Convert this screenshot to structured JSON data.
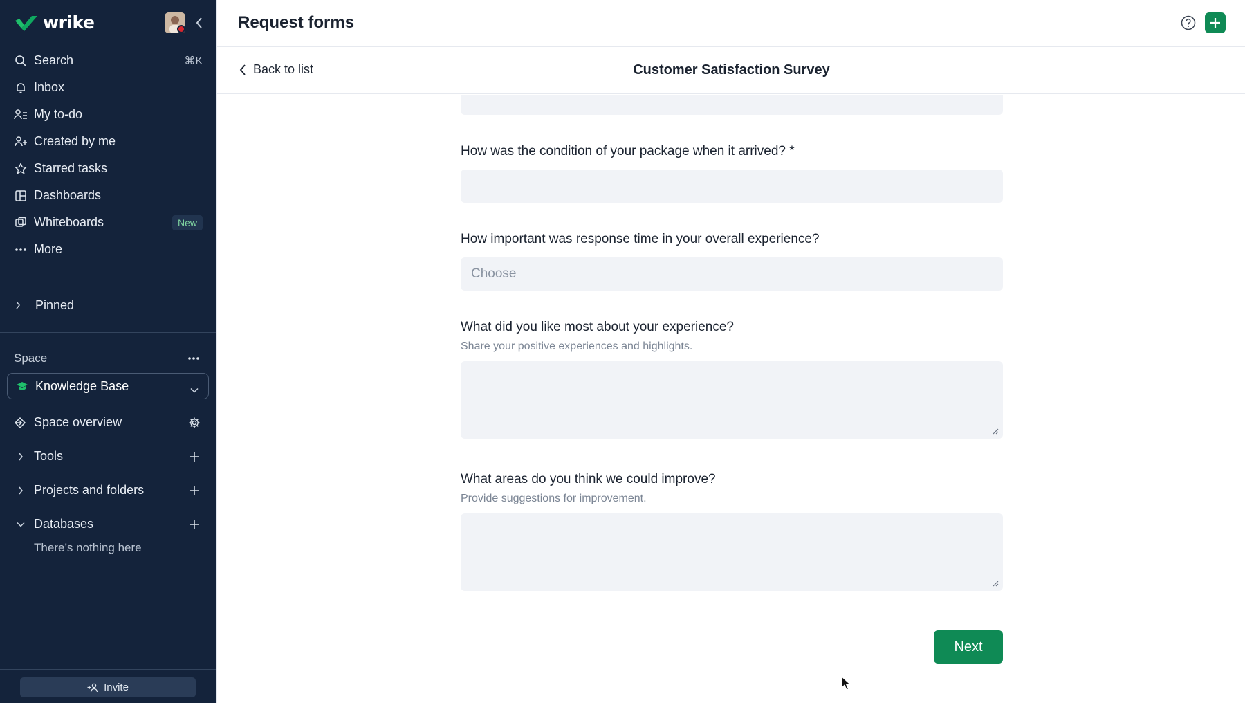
{
  "app": {
    "logo_text": "wrike"
  },
  "sidebar": {
    "nav": [
      {
        "label": "Search",
        "icon": "search-icon",
        "shortcut": "⌘K"
      },
      {
        "label": "Inbox",
        "icon": "bell-icon"
      },
      {
        "label": "My to-do",
        "icon": "person-list-icon"
      },
      {
        "label": "Created by me",
        "icon": "person-plus-icon"
      },
      {
        "label": "Starred tasks",
        "icon": "star-icon"
      },
      {
        "label": "Dashboards",
        "icon": "dashboard-icon"
      },
      {
        "label": "Whiteboards",
        "icon": "whiteboard-icon",
        "badge": "New"
      },
      {
        "label": "More",
        "icon": "more-horizontal-icon"
      }
    ],
    "pinned_label": "Pinned",
    "space": {
      "label": "Space",
      "selected": "Knowledge Base"
    },
    "tree": [
      {
        "label": "Space overview",
        "lead_icon": "space-overview-icon",
        "trail_icon": "gear-icon"
      },
      {
        "label": "Tools",
        "lead_icon": "chevron-right-icon",
        "trail_icon": "plus-icon"
      },
      {
        "label": "Projects and folders",
        "lead_icon": "chevron-right-icon",
        "trail_icon": "plus-icon"
      },
      {
        "label": "Databases",
        "lead_icon": "chevron-down-icon",
        "trail_icon": "plus-icon"
      }
    ],
    "databases_empty": "There’s nothing here",
    "invite_label": "Invite"
  },
  "header": {
    "title": "Request forms"
  },
  "subheader": {
    "back_label": "Back to list",
    "form_title": "Customer Satisfaction Survey"
  },
  "form": {
    "q_condition": {
      "label": "How was the condition of your package when it arrived? *"
    },
    "q_response_time": {
      "label": "How important was response time in your overall experience?",
      "placeholder": "Choose"
    },
    "q_liked": {
      "label": "What did you like most about your experience?",
      "hint": "Share your positive experiences and highlights."
    },
    "q_improve": {
      "label": "What areas do you think we could improve?",
      "hint": "Provide suggestions for improvement."
    },
    "next_label": "Next"
  },
  "colors": {
    "sidebar_bg": "#14233b",
    "accent_green": "#0f8a55",
    "field_bg": "#f1f3f7"
  }
}
